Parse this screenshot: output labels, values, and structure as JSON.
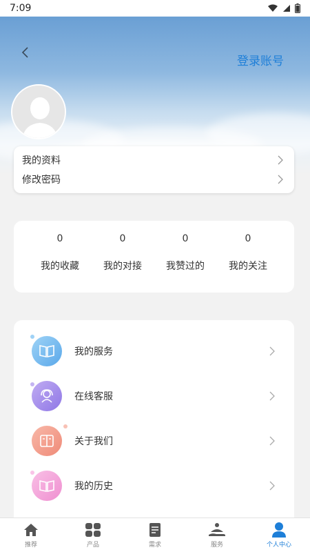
{
  "status": {
    "time": "7:09"
  },
  "header": {
    "login_label": "登录账号"
  },
  "profile_menu": [
    {
      "label": "我的资料"
    },
    {
      "label": "修改密码"
    }
  ],
  "stats": [
    {
      "value": "0",
      "label": "我的收藏"
    },
    {
      "value": "0",
      "label": "我的对接"
    },
    {
      "value": "0",
      "label": "我赞过的"
    },
    {
      "value": "0",
      "label": "我的关注"
    }
  ],
  "menu": [
    {
      "label": "我的服务",
      "icon": "book-icon",
      "color_from": "#8cc8f2",
      "color_to": "#5aa8ea"
    },
    {
      "label": "在线客服",
      "icon": "customer-service-icon",
      "color_from": "#b9a4f0",
      "color_to": "#8f77e6"
    },
    {
      "label": "关于我们",
      "icon": "document-icon",
      "color_from": "#f8b2a2",
      "color_to": "#ef8a78"
    },
    {
      "label": "我的历史",
      "icon": "history-icon",
      "color_from": "#f9b9e4",
      "color_to": "#ef8fd0"
    }
  ],
  "tabs": [
    {
      "label": "推荐",
      "icon": "home-icon",
      "active": false
    },
    {
      "label": "产品",
      "icon": "grid-icon",
      "active": false
    },
    {
      "label": "需求",
      "icon": "requirement-icon",
      "active": false
    },
    {
      "label": "服务",
      "icon": "service-icon",
      "active": false
    },
    {
      "label": "个人中心",
      "icon": "person-icon",
      "active": true
    }
  ],
  "colors": {
    "accent": "#1e7fd8",
    "page_bg": "#f2f2f2"
  }
}
